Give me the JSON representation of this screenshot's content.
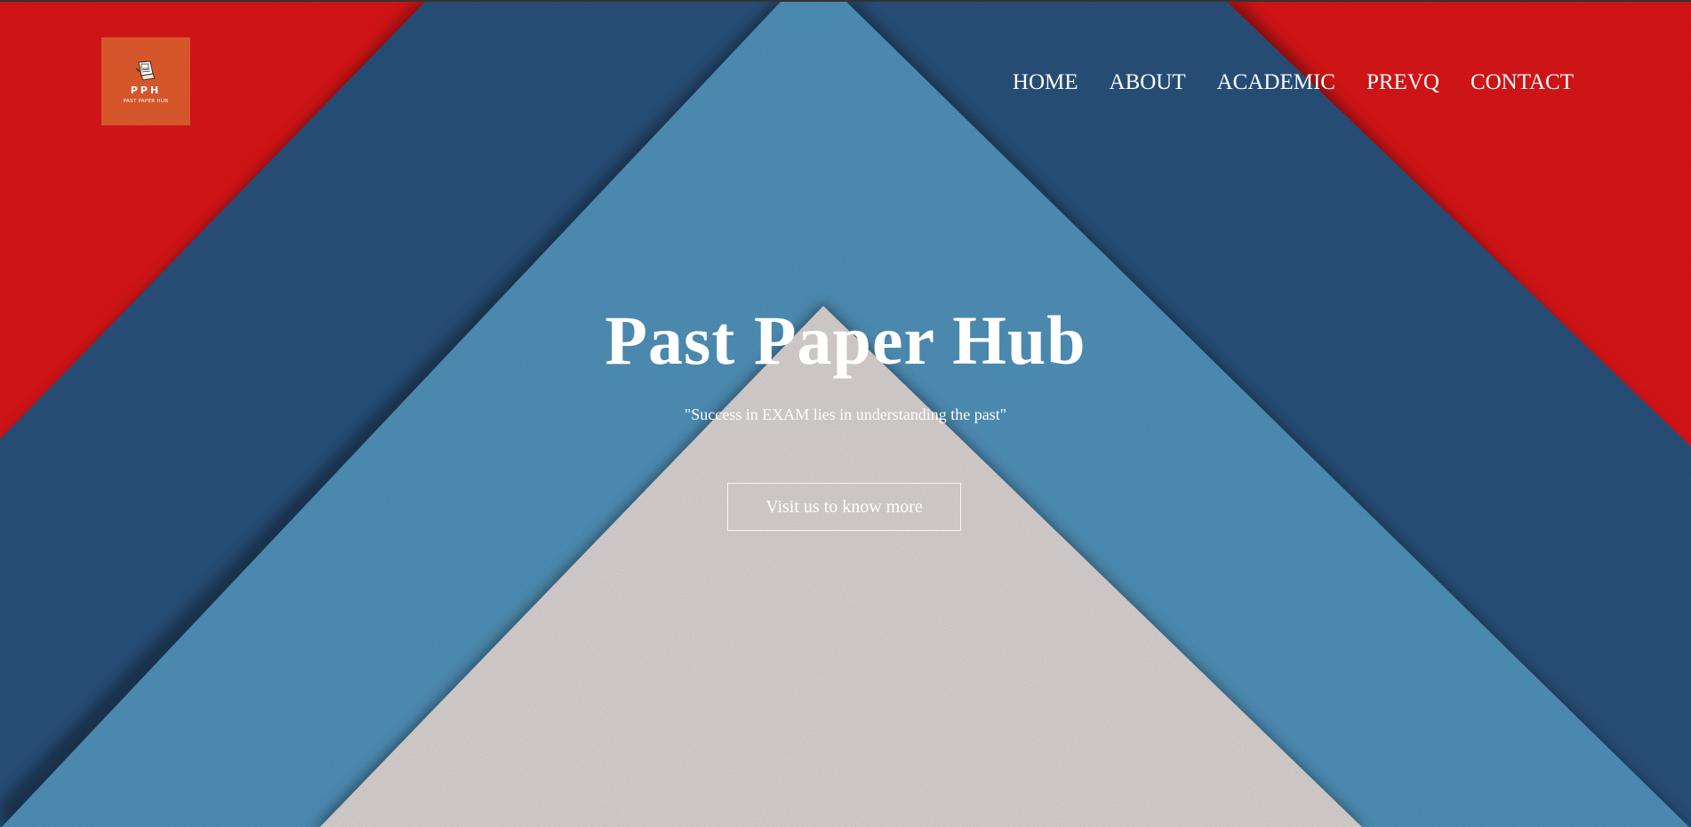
{
  "brand": {
    "abbr": "PPH",
    "name": "PAST PAPER HUB",
    "logo_icon": "document-scroll-icon",
    "logo_color": "#d4562a"
  },
  "nav": {
    "items": [
      "HOME",
      "ABOUT",
      "ACADEMIC",
      "PREVQ",
      "CONTACT"
    ]
  },
  "hero": {
    "title": "Past Paper Hub",
    "tagline": "\"Success in EXAM lies in understanding the past\"",
    "cta_label": "Visit us to know more"
  },
  "colors": {
    "red": "#d81517",
    "navy": "#28507a",
    "sky": "#4f8fb7",
    "paper": "#d6d0cf",
    "text": "#ffffff"
  }
}
